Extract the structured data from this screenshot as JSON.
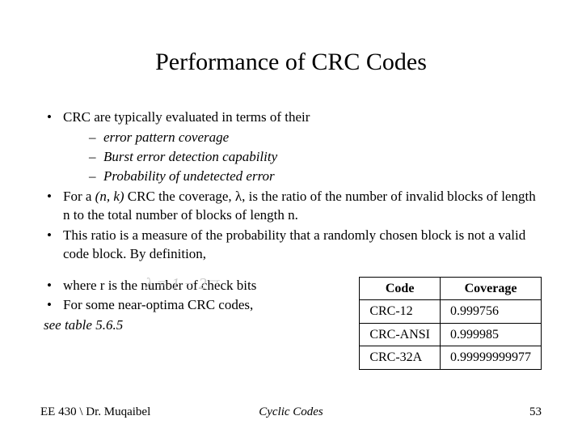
{
  "title": "Performance of CRC Codes",
  "bullets": {
    "b1": "CRC are typically evaluated in terms of their",
    "sub1": "error pattern coverage",
    "sub2": "Burst error detection capability",
    "sub3": "Probability of undetected error",
    "b2_pre": "For a ",
    "b2_nk": "(n, k)",
    "b2_post": " CRC the coverage, λ, is the ratio of the number of invalid blocks of length n to the total number of blocks of length n.",
    "b3": "This ratio is a measure of the probability that a randomly chosen block is not a valid code block. By definition,",
    "b4": "where r is the number of check bits",
    "b5": "For some near-optima CRC codes,",
    "see": "see table 5.6.5"
  },
  "equation_overlay": "λ = 1 − 2⁻ʳ",
  "table": {
    "h1": "Code",
    "h2": "Coverage",
    "rows": [
      {
        "code": "CRC-12",
        "cov": "0.999756"
      },
      {
        "code": "CRC-ANSI",
        "cov": "0.999985"
      },
      {
        "code": "CRC-32A",
        "cov": "0.99999999977"
      }
    ]
  },
  "footer": {
    "left": "EE 430 \\ Dr. Muqaibel",
    "center": "Cyclic Codes",
    "right": "53"
  }
}
